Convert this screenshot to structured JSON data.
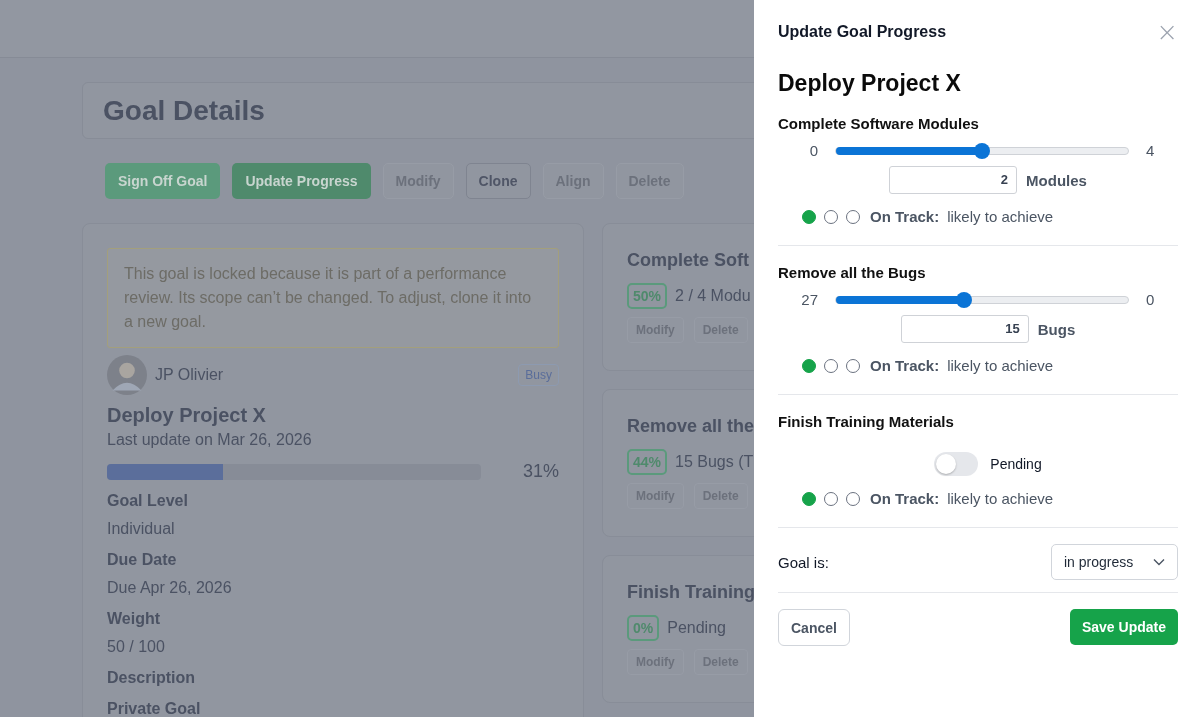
{
  "page": {
    "title": "Goal Details",
    "actions": [
      {
        "label": "Sign Off Goal",
        "kind": "primary",
        "disabled": false
      },
      {
        "label": "Update Progress",
        "kind": "primary-dark",
        "disabled": false
      },
      {
        "label": "Modify",
        "kind": "outline",
        "disabled": true
      },
      {
        "label": "Clone",
        "kind": "outline",
        "disabled": false
      },
      {
        "label": "Align",
        "kind": "outline",
        "disabled": true
      },
      {
        "label": "Delete",
        "kind": "outline",
        "disabled": true
      }
    ],
    "notice": "This goal is locked because it is part of a performance review. Its scope can’t be changed. To adjust, clone it into a new goal.",
    "owner": {
      "name": "JP Olivier",
      "badge": "Busy"
    },
    "goal": {
      "name": "Deploy Project X",
      "updated": "Last update on Mar 26, 2026",
      "level": 0.31,
      "percent": "31%"
    },
    "fields": [
      {
        "label": "Goal Level",
        "value": "Individual"
      },
      {
        "label": "Due Date",
        "value": "Due Apr 26, 2026"
      },
      {
        "label": "Weight",
        "value": "50 / 100"
      },
      {
        "label": "Description"
      },
      {
        "label": "Private Goal"
      }
    ],
    "metric_cards": [
      {
        "title": "Complete Soft",
        "percent": "50%",
        "summary": "2 / 4 Modu",
        "buttons": [
          {
            "label": "Modify",
            "disabled": true
          },
          {
            "label": "Delete",
            "disabled": true
          }
        ]
      },
      {
        "title": "Remove all the",
        "percent": "44%",
        "summary": "15 Bugs (T",
        "buttons": [
          {
            "label": "Modify",
            "disabled": true
          },
          {
            "label": "Delete",
            "disabled": true
          }
        ]
      },
      {
        "title": "Finish Training",
        "percent": "0%",
        "summary": "Pending",
        "buttons": [
          {
            "label": "Modify",
            "disabled": true
          },
          {
            "label": "Delete",
            "disabled": true
          }
        ]
      }
    ]
  },
  "drawer": {
    "title": "Update Goal Progress",
    "close": "×",
    "heading": "Deploy Project X",
    "metrics": [
      {
        "kind": "slider",
        "name": "Complete Software Modules",
        "min": "0",
        "max": "4",
        "level": 0.5,
        "value": "2",
        "unit": "Modules",
        "status": [
          {
            "selected": true
          },
          {
            "selected": false
          },
          {
            "selected": false
          }
        ],
        "status_label": "On Track:",
        "status_text": "likely to achieve"
      },
      {
        "kind": "slider",
        "name": "Remove all the Bugs",
        "min": "27",
        "max": "0",
        "level": 0.44,
        "value": "15",
        "unit": "Bugs",
        "status": [
          {
            "selected": true
          },
          {
            "selected": false
          },
          {
            "selected": false
          }
        ],
        "status_label": "On Track:",
        "status_text": "likely to achieve"
      },
      {
        "kind": "toggle",
        "name": "Finish Training Materials",
        "on": false,
        "toggle_label": "Pending",
        "status": [
          {
            "selected": true
          },
          {
            "selected": false
          },
          {
            "selected": false
          }
        ],
        "status_label": "On Track:",
        "status_text": "likely to achieve"
      }
    ],
    "goal_state": {
      "label": "Goal is:",
      "value": "in progress"
    },
    "cancel": "Cancel",
    "save": "Save Update"
  }
}
